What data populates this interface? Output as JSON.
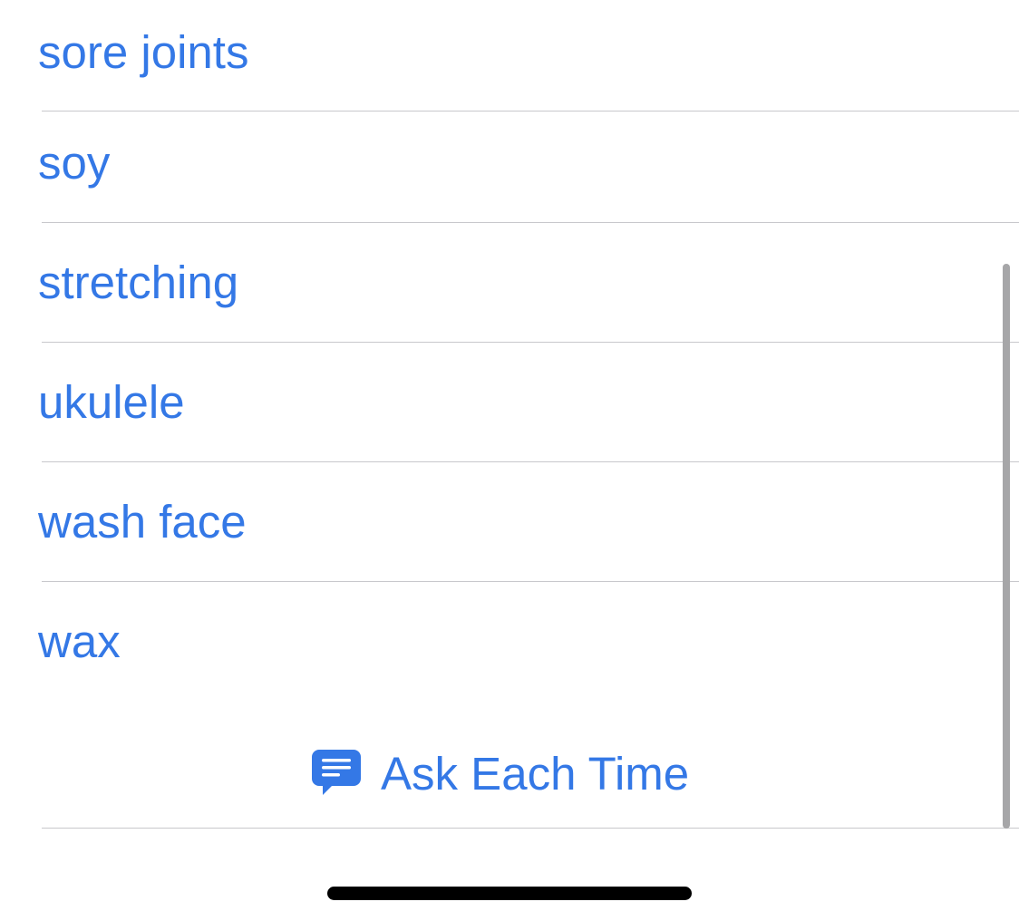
{
  "list": {
    "items": [
      {
        "label": "sore joints"
      },
      {
        "label": "soy"
      },
      {
        "label": "stretching"
      },
      {
        "label": "ukulele"
      },
      {
        "label": "wash face"
      },
      {
        "label": "wax"
      }
    ]
  },
  "ask_each_time": {
    "label": "Ask Each Time",
    "icon": "message-bubble-icon"
  },
  "colors": {
    "accent": "#3478e6",
    "separator": "#c8c8cc",
    "scrollbar": "#a6a6a8",
    "home_indicator": "#000000",
    "background": "#ffffff"
  }
}
